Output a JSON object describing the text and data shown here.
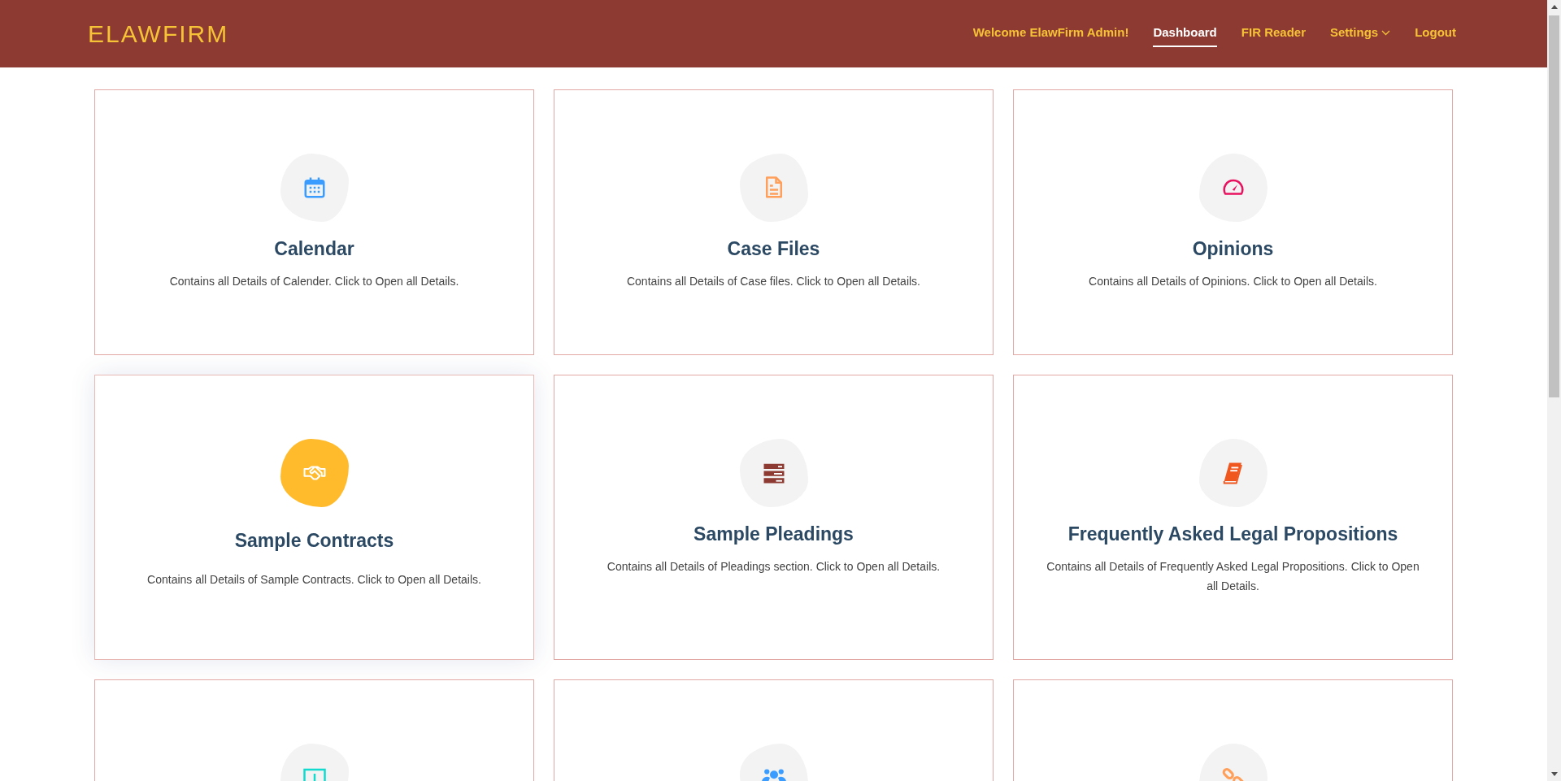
{
  "brand": "ELAWFIRM",
  "nav": [
    {
      "label": "Welcome ElawFirm Admin!",
      "selected": false,
      "dropdown": false
    },
    {
      "label": "Dashboard",
      "selected": true,
      "dropdown": false
    },
    {
      "label": "FIR Reader",
      "selected": false,
      "dropdown": false
    },
    {
      "label": "Settings",
      "selected": false,
      "dropdown": true
    },
    {
      "label": "Logout",
      "selected": false,
      "dropdown": false
    }
  ],
  "cards": [
    {
      "kind": "calendar",
      "color": "#3b9cff",
      "title": "Calendar",
      "description": "Contains all Details of Calender. Click to Open all Details.",
      "highlighted": false
    },
    {
      "kind": "file",
      "color": "#ff9f5a",
      "title": "Case Files",
      "description": "Contains all Details of Case files. Click to Open all Details.",
      "highlighted": false
    },
    {
      "kind": "gauge",
      "color": "#e9125f",
      "title": "Opinions",
      "description": "Contains all Details of Opinions. Click to Open all Details.",
      "highlighted": false
    },
    {
      "kind": "handshake",
      "color": "#ffbb2c",
      "title": "Sample Contracts",
      "description": "Contains all Details of Sample Contracts. Click to Open all Details.",
      "highlighted": true
    },
    {
      "kind": "server",
      "color": "#8d3a32",
      "title": "Sample Pleadings",
      "description": "Contains all Details of Pleadings section. Click to Open all Details.",
      "highlighted": false
    },
    {
      "kind": "book",
      "color": "#f0571f",
      "title": "Frequently Asked Legal Propositions",
      "description": "Contains all Details of Frequently Asked Legal Propositions. Click to Open all Details.",
      "highlighted": false
    },
    {
      "kind": "money",
      "color": "#11dbcf",
      "highlighted": false
    },
    {
      "kind": "users",
      "color": "#3b9cff",
      "highlighted": false
    },
    {
      "kind": "link",
      "color": "#ff9f5a",
      "highlighted": false
    }
  ]
}
